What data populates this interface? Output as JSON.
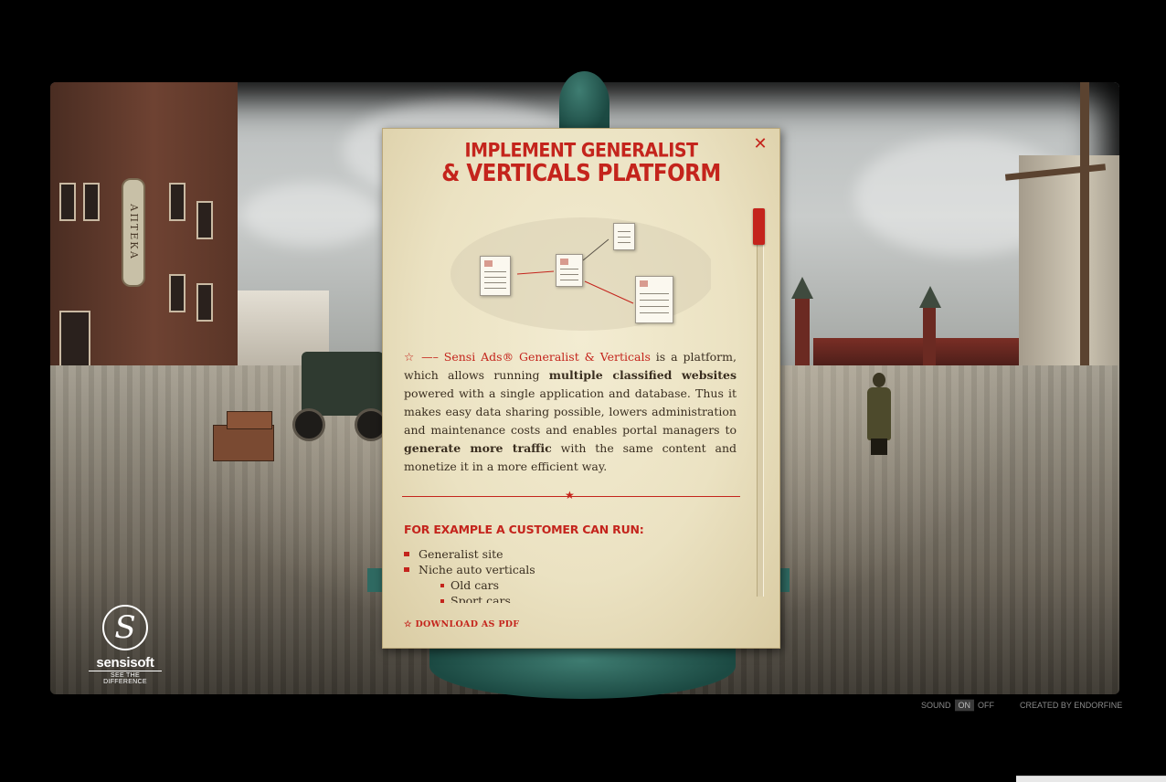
{
  "poster": {
    "title_line1": "IMPLEMENT GENERALIST",
    "title_line2": "& VERTICALS PLATFORM",
    "close_icon": "✕",
    "intro": {
      "star": "☆",
      "dash": " —– ",
      "product": "Sensi Ads® Generalist & Verticals",
      "text1": " is a platform, which allows running ",
      "bold1": "multiple classified websites",
      "text2": " powered with a single application and database. Thus it makes easy data sharing possible, lowers administration and maintenance costs and enables portal managers to ",
      "bold2": "generate more traffic",
      "text3": " with the same content and monetize it in a more efficient way."
    },
    "divider_star": "★",
    "subheading": "FOR EXAMPLE A CUSTOMER CAN RUN:",
    "list": [
      "Generalist site",
      "Niche auto verticals"
    ],
    "sublist": [
      "Old cars",
      "Sport cars"
    ],
    "download_star": "☆",
    "download_label": "DOWNLOAD AS PDF"
  },
  "scene": {
    "pharmacy_sign": "АПТЕКА"
  },
  "logo": {
    "mark": "S",
    "name": "sensisoft",
    "tagline": "SEE THE DIFFERENCE"
  },
  "footer": {
    "sound_label": "SOUND",
    "sound_on": "ON",
    "sound_off": "OFF",
    "credit": "CREATED BY ENDORFINE"
  },
  "colors": {
    "accent_red": "#c4241c",
    "paper": "#ebe2c2",
    "background": "#000000"
  }
}
